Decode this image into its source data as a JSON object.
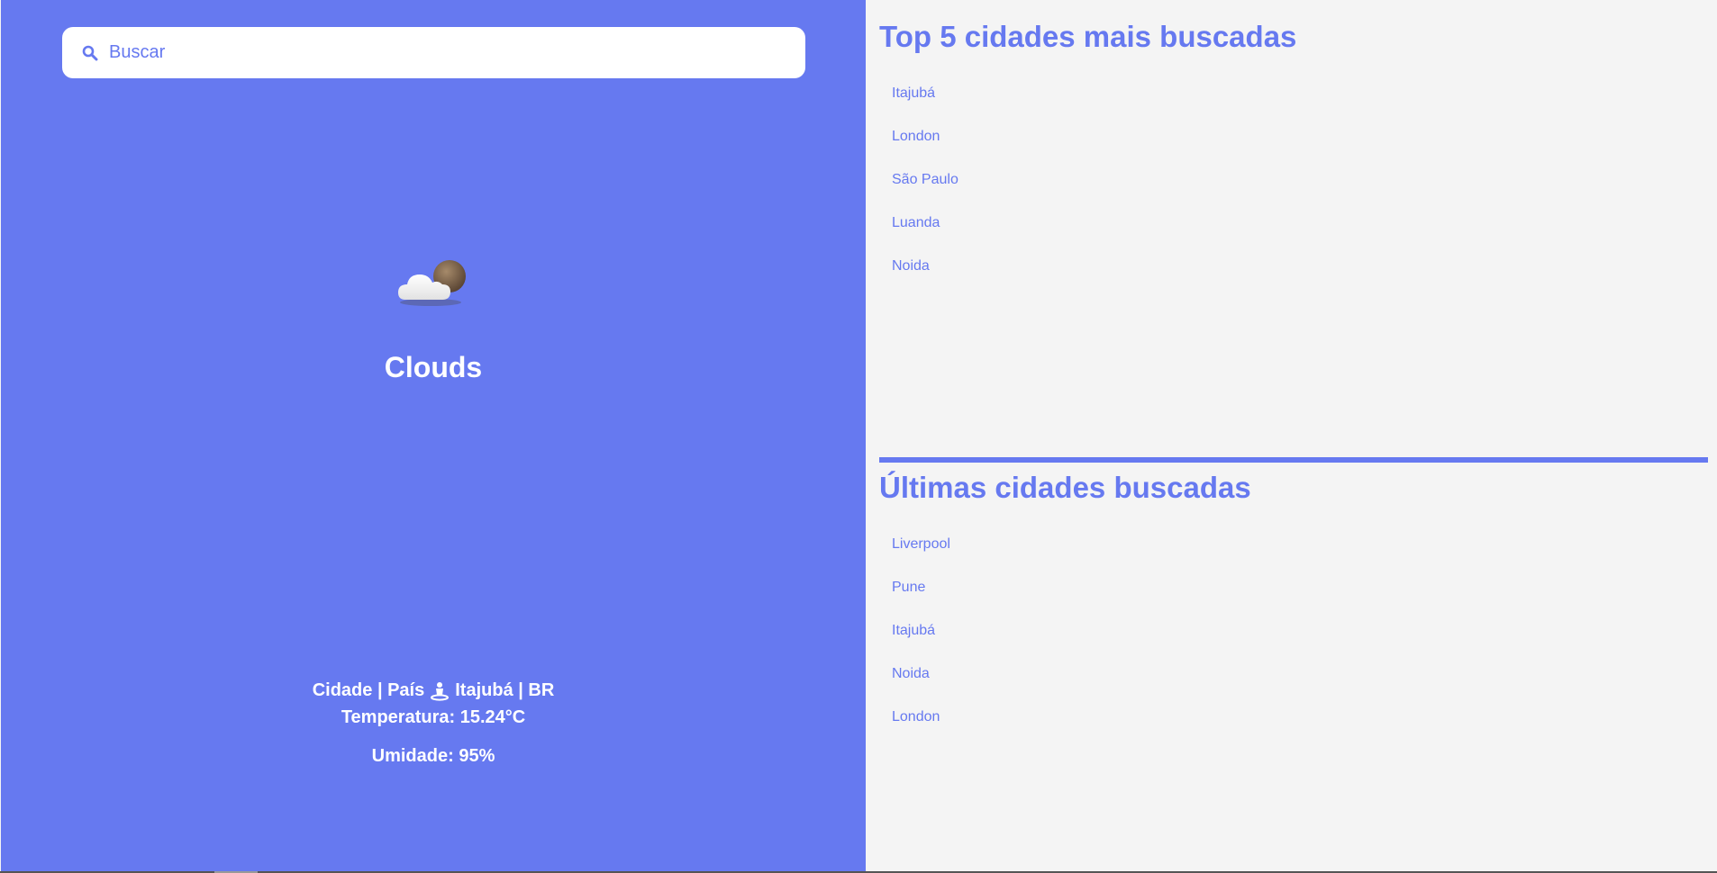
{
  "search": {
    "placeholder": "Buscar",
    "value": ""
  },
  "weather": {
    "condition": "Clouds",
    "location_label": "Cidade | País",
    "location_value": "Itajubá | BR",
    "temperature": "Temperatura: 15.24°C",
    "humidity": "Umidade: 95%"
  },
  "top5": {
    "title": "Top 5 cidades mais buscadas",
    "items": [
      "Itajubá",
      "London",
      "São Paulo",
      "Luanda",
      "Noida"
    ]
  },
  "recent": {
    "title": "Últimas cidades buscadas",
    "items": [
      "Liverpool",
      "Pune",
      "Itajubá",
      "Noida",
      "London"
    ]
  },
  "colors": {
    "accent": "#6679f0",
    "panel_bg": "#f4f4f4",
    "text_on_accent": "#ffffff"
  },
  "icons": {
    "search": "search-icon",
    "weather": "cloud-sun-icon",
    "location": "person-pin-icon"
  }
}
